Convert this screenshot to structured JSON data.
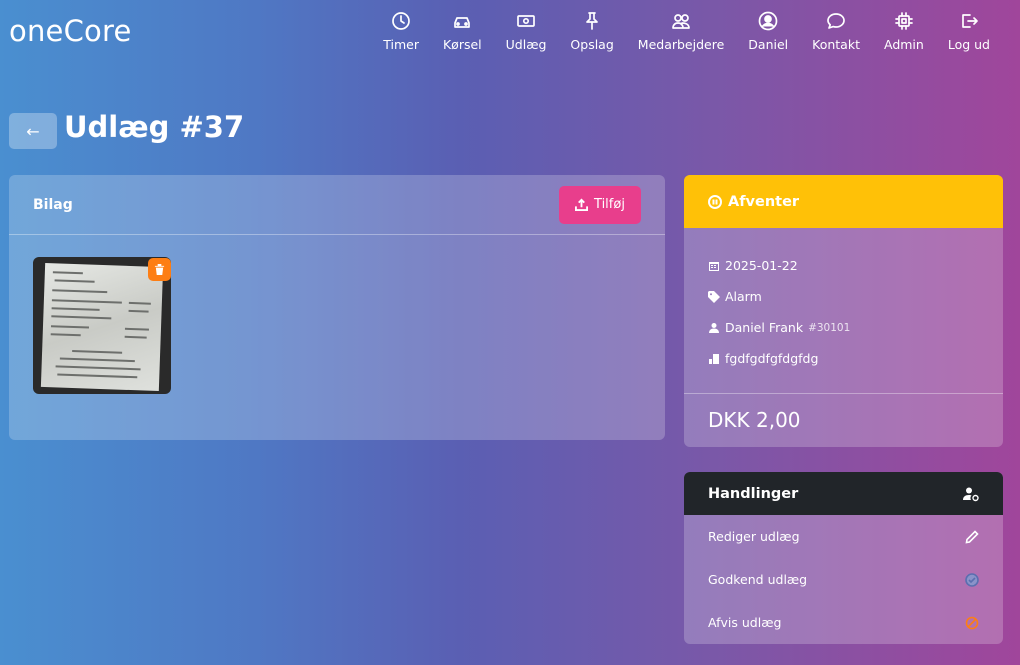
{
  "brand": "oneCore",
  "nav": [
    {
      "label": "Timer",
      "icon": "clock-icon"
    },
    {
      "label": "Kørsel",
      "icon": "car-icon"
    },
    {
      "label": "Udlæg",
      "icon": "cash-icon"
    },
    {
      "label": "Opslag",
      "icon": "pin-icon"
    },
    {
      "label": "Medarbejdere",
      "icon": "people-icon"
    },
    {
      "label": "Daniel",
      "icon": "user-circle-icon"
    },
    {
      "label": "Kontakt",
      "icon": "chat-icon"
    },
    {
      "label": "Admin",
      "icon": "cpu-icon"
    },
    {
      "label": "Log ud",
      "icon": "logout-icon"
    }
  ],
  "back_label": "←",
  "page_title": "Udlæg #37",
  "bilag": {
    "title": "Bilag",
    "add_label": "Tilføj"
  },
  "status": {
    "label": "Afventer",
    "color": "#ffc107",
    "date": "2025-01-22",
    "category": "Alarm",
    "employee": "Daniel Frank",
    "employee_id": "#30101",
    "description": "fgdfgdfgfdgfdg",
    "amount": "DKK 2,00"
  },
  "actions": {
    "title": "Handlinger",
    "items": [
      {
        "label": "Rediger udlæg",
        "icon": "pencil-icon"
      },
      {
        "label": "Godkend udlæg",
        "icon": "check-circle-icon"
      },
      {
        "label": "Afvis udlæg",
        "icon": "slash-circle-icon"
      }
    ]
  }
}
